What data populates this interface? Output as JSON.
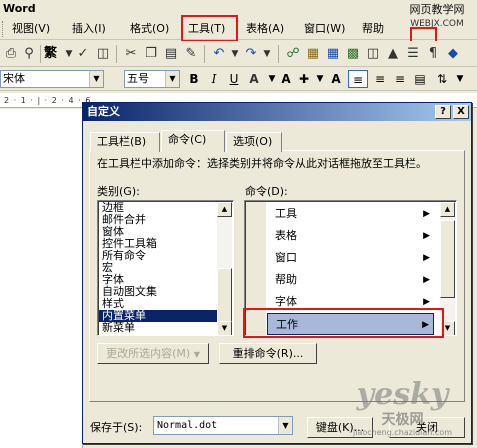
{
  "app_title": "Word",
  "menu": {
    "items": [
      {
        "label": "视图(V)"
      },
      {
        "label": "插入(I)"
      },
      {
        "label": "格式(O)"
      },
      {
        "label": "工具(T)"
      },
      {
        "label": "表格(A)"
      },
      {
        "label": "窗口(W)"
      },
      {
        "label": "帮助"
      }
    ]
  },
  "watermark_top": {
    "line1": "网页教学网",
    "line2": "WEBJX.COM"
  },
  "toolbar": {
    "traditional_label": "繁"
  },
  "format_bar": {
    "font_name": "宋体",
    "font_size": "五号",
    "bold": "B",
    "italic": "I",
    "underline": "U"
  },
  "ruler_text": "2 · 1 · | · 2 · 4 · 6",
  "dialog": {
    "title": "自定义",
    "help_btn": "?",
    "close_btn": "X",
    "tabs": [
      {
        "label": "工具栏(B)"
      },
      {
        "label": "命令(C)"
      },
      {
        "label": "选项(O)"
      }
    ],
    "description": "在工具栏中添加命令：选择类别并将命令从此对话框拖放至工具栏。",
    "categories_label": "类别(G):",
    "commands_label": "命令(D):",
    "categories": [
      "边框",
      "邮件合并",
      "窗体",
      "控件工具箱",
      "所有命令",
      "宏",
      "字体",
      "自动图文集",
      "样式",
      "内置菜单",
      "新菜单"
    ],
    "selected_category": "内置菜单",
    "commands": [
      {
        "label": "工具"
      },
      {
        "label": "表格"
      },
      {
        "label": "窗口"
      },
      {
        "label": "帮助"
      },
      {
        "label": "字体"
      },
      {
        "label": "工作"
      }
    ],
    "selected_command": "工作",
    "modify_selection_btn": "更改所选内容(M)",
    "rearrange_btn": "重排命令(R)...",
    "save_in_label": "保存于(S):",
    "save_in_value": "Normal.dot",
    "keyboard_btn": "键盘(K)...",
    "close_action_btn": "关闭"
  },
  "watermark": {
    "brand": "yesky",
    "brand_cn": "天极网",
    "site": "jiaocheng.chazidian.com"
  },
  "colors": {
    "highlight_red": "#e01818",
    "title_blue": "#0a246a",
    "selection_blue": "#0a246a",
    "command_selected": "#a8b8d8"
  }
}
